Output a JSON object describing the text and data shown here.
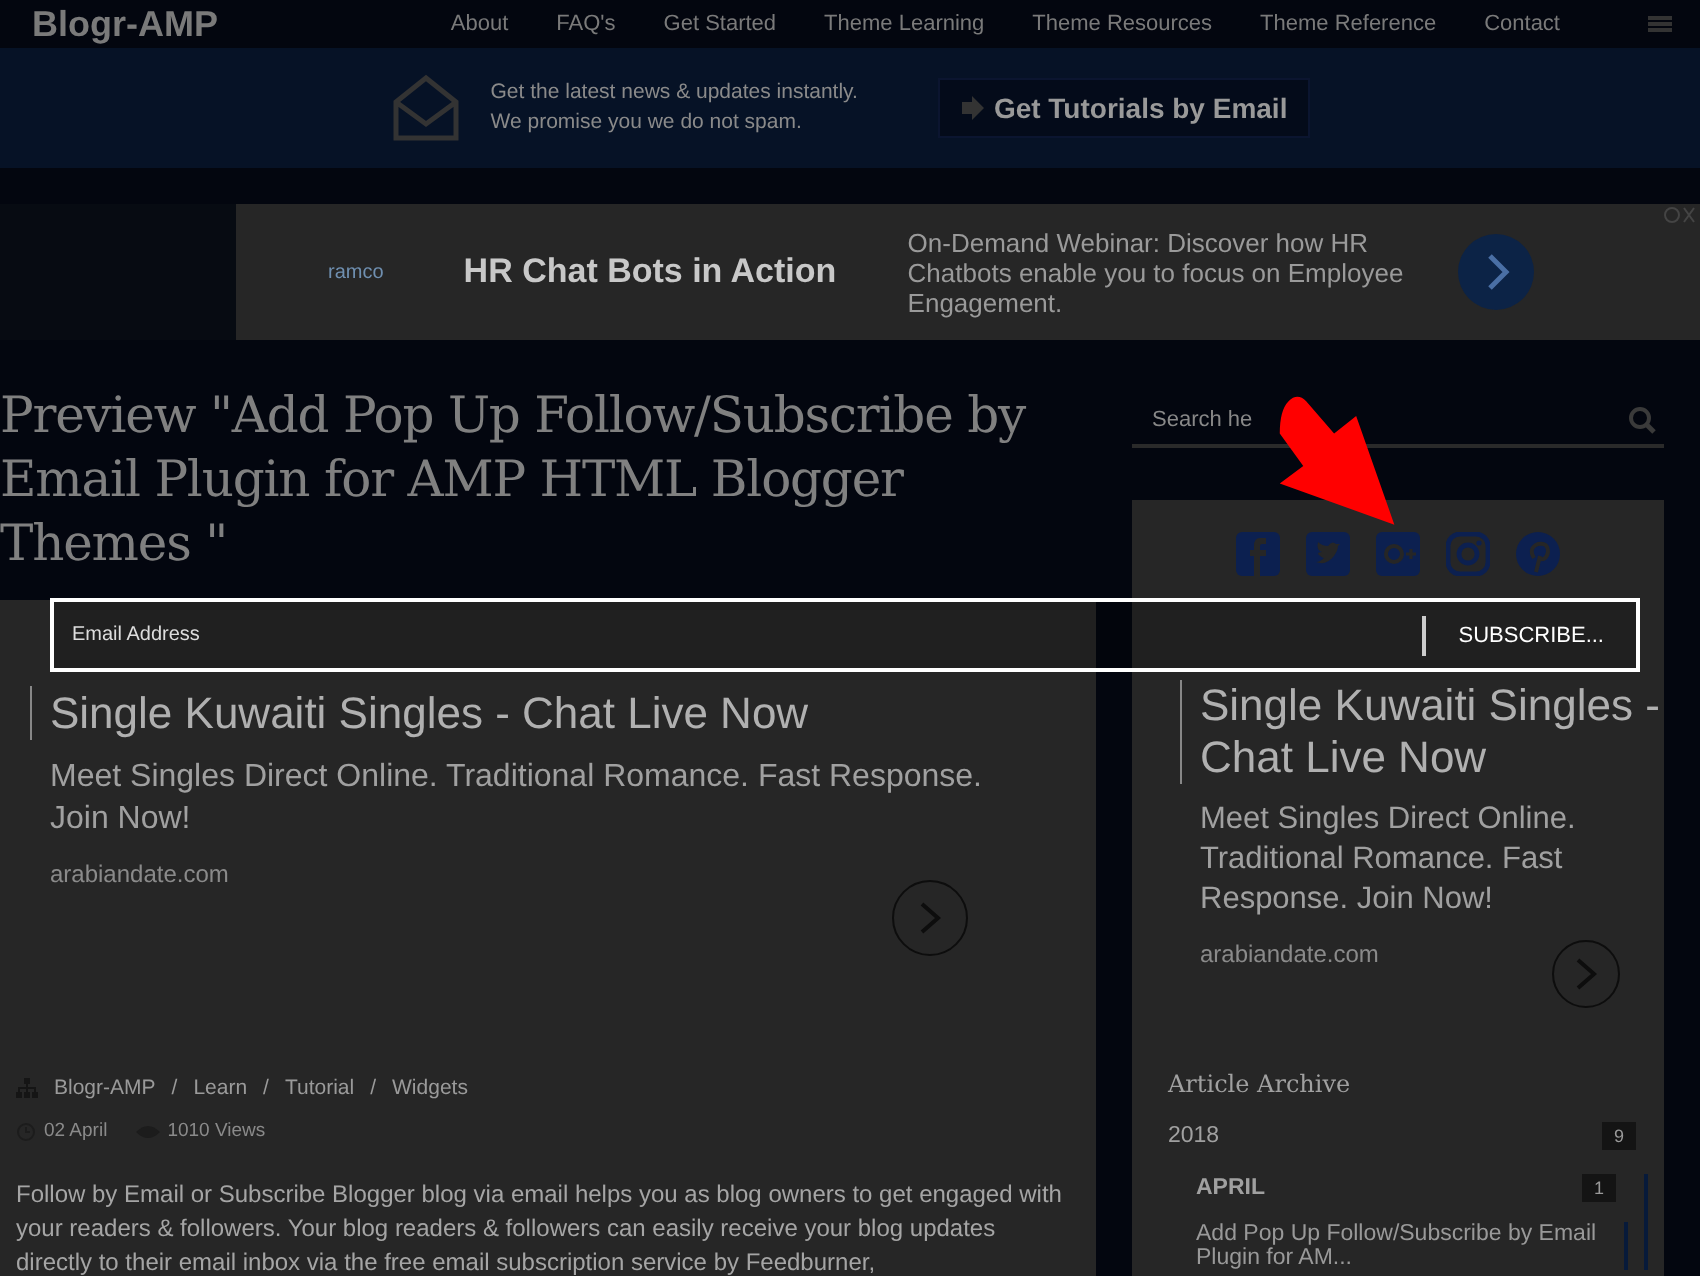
{
  "nav": {
    "logo": "Blogr-AMP",
    "links": [
      "About",
      "FAQ's",
      "Get Started",
      "Theme Learning",
      "Theme Resources",
      "Theme Reference",
      "Contact"
    ]
  },
  "banner": {
    "lines": [
      "Get the latest news & updates instantly.",
      "We promise you we do not spam."
    ],
    "button": "Get Tutorials by Email"
  },
  "top_ad": {
    "brand": "ramco",
    "headline": "HR Chat Bots in Action",
    "description": "On-Demand Webinar: Discover how HR Chatbots enable you to focus on Employee Engagement."
  },
  "post": {
    "title": "Preview \"Add Pop Up Follow/Subscribe by Email Plugin for AMP HTML Blogger Themes \"",
    "ad": {
      "headline": "Single Kuwaiti Singles - Chat Live Now",
      "description": "Meet Singles Direct Online. Traditional Romance. Fast Response. Join Now!",
      "domain": "arabiandate.com"
    },
    "breadcrumb": [
      {
        "label": "Blogr-AMP"
      },
      {
        "separator": "/",
        "label": "Learn"
      },
      {
        "separator": "/",
        "label": "Tutorial"
      },
      {
        "separator": "/",
        "label": "Widgets"
      }
    ],
    "date": "02 April",
    "views": "1010 Views",
    "body": "Follow by Email or Subscribe Blogger blog via email helps you as blog owners to get engaged with your readers & followers.  Your blog readers & followers can easily receive your blog updates directly to their email inbox via the free email subscription service by Feedburner,"
  },
  "sidebar": {
    "search": {
      "placeholder": "Search he"
    },
    "ad": {
      "headline": "Single Kuwaiti Singles - Chat Live Now",
      "description": "Meet Singles Direct Online. Traditional Romance. Fast Response. Join Now!",
      "domain": "arabiandate.com"
    },
    "archive": {
      "title": "Article Archive",
      "items": [
        {
          "label": "2018",
          "count": "9",
          "expanded": true,
          "children": [
            {
              "label": "APRIL",
              "count": "1",
              "expanded": true,
              "children": [
                {
                  "label": "Add Pop Up Follow/Subscribe by Email Plugin for AM..."
                }
              ]
            }
          ]
        }
      ]
    }
  },
  "subscribe_bar": {
    "placeholder": "Email Address",
    "button": "SUBSCRIBE..."
  }
}
